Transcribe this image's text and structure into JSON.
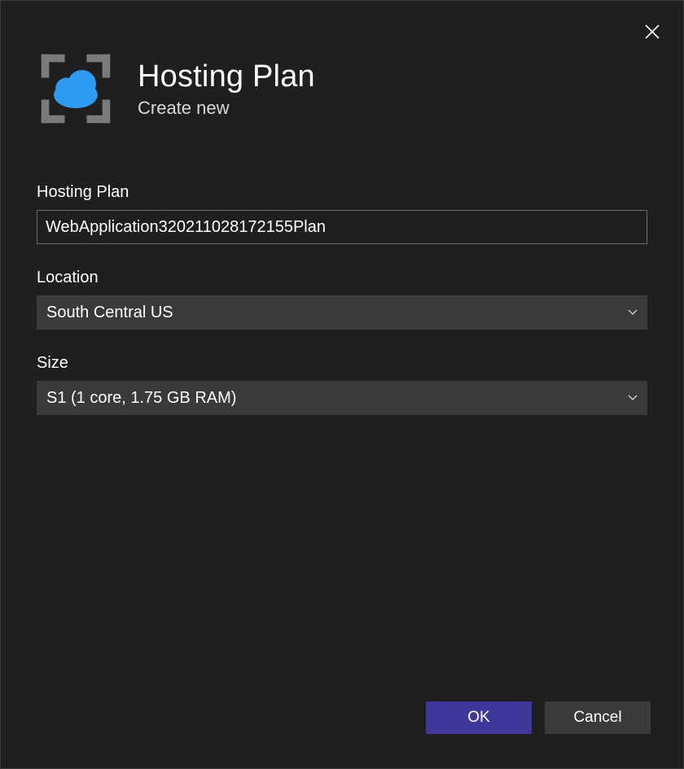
{
  "header": {
    "title": "Hosting Plan",
    "subtitle": "Create new"
  },
  "form": {
    "hosting_plan": {
      "label": "Hosting Plan",
      "value": "WebApplication320211028172155Plan"
    },
    "location": {
      "label": "Location",
      "value": "South Central US"
    },
    "size": {
      "label": "Size",
      "value": "S1 (1 core, 1.75 GB RAM)"
    }
  },
  "footer": {
    "ok": "OK",
    "cancel": "Cancel"
  }
}
